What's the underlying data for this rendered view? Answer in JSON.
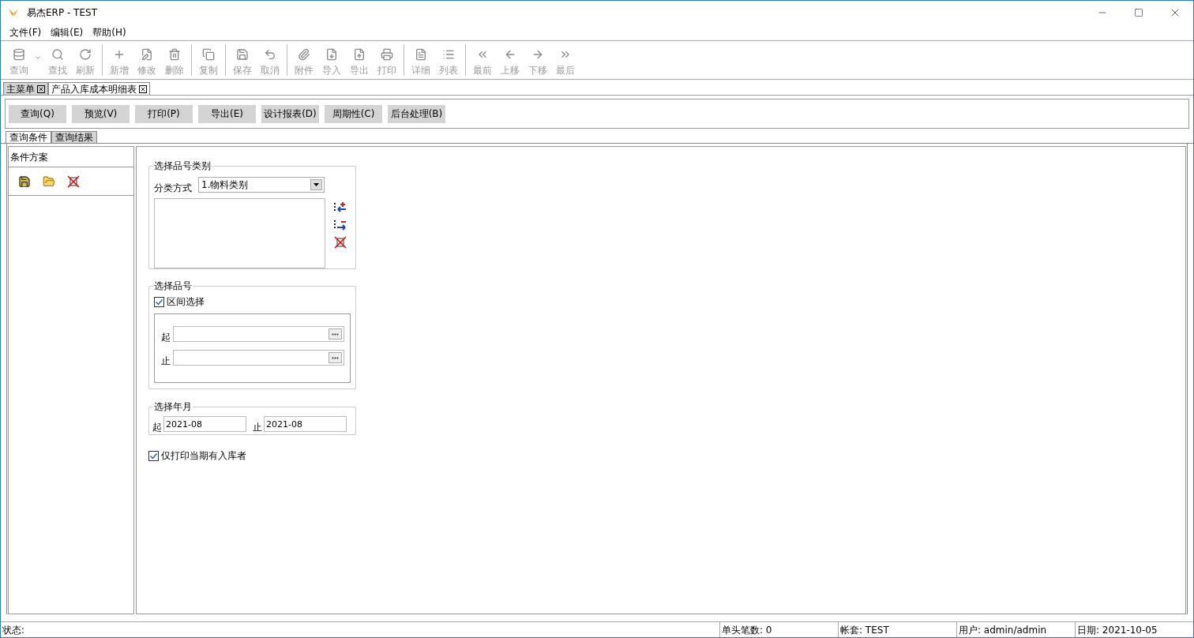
{
  "window": {
    "title": "易杰ERP - TEST"
  },
  "menu": [
    {
      "label": "文件(F)"
    },
    {
      "label": "编辑(E)"
    },
    {
      "label": "帮助(H)"
    }
  ],
  "toolbar": [
    [
      {
        "label": "查询",
        "disabled": true,
        "dropdown": true
      },
      {
        "label": "查找",
        "disabled": true,
        "dropdown": false
      },
      {
        "label": "刷新",
        "disabled": true,
        "dropdown": false
      }
    ],
    [
      {
        "label": "新增",
        "disabled": true,
        "dropdown": false
      },
      {
        "label": "修改",
        "disabled": true,
        "dropdown": false
      },
      {
        "label": "删除",
        "disabled": true,
        "dropdown": false
      }
    ],
    [
      {
        "label": "复制",
        "disabled": true,
        "dropdown": false
      }
    ],
    [
      {
        "label": "保存",
        "disabled": true,
        "dropdown": false
      },
      {
        "label": "取消",
        "disabled": true,
        "dropdown": false
      }
    ],
    [
      {
        "label": "附件",
        "disabled": true,
        "dropdown": false
      },
      {
        "label": "导入",
        "disabled": true,
        "dropdown": false
      },
      {
        "label": "导出",
        "disabled": true,
        "dropdown": false
      },
      {
        "label": "打印",
        "disabled": true,
        "dropdown": false
      }
    ],
    [
      {
        "label": "详细",
        "disabled": true,
        "dropdown": false
      },
      {
        "label": "列表",
        "disabled": true,
        "dropdown": false
      }
    ],
    [
      {
        "label": "最前",
        "disabled": true,
        "dropdown": false
      },
      {
        "label": "上移",
        "disabled": true,
        "dropdown": false
      },
      {
        "label": "下移",
        "disabled": true,
        "dropdown": false
      },
      {
        "label": "最后",
        "disabled": true,
        "dropdown": false
      }
    ]
  ],
  "doc_tabs": [
    {
      "label": "主菜单",
      "selected": false
    },
    {
      "label": "产品入库成本明细表",
      "selected": true
    }
  ],
  "actions": [
    "查询(Q)",
    "预览(V)",
    "打印(P)",
    "导出(E)",
    "设计报表(D)",
    "周期性(C)",
    "后台处理(B)"
  ],
  "sub_tabs": [
    {
      "label": "查询条件",
      "selected": true
    },
    {
      "label": "查询结果",
      "selected": false
    }
  ],
  "scheme_panel": {
    "title": "条件方案"
  },
  "category_group": {
    "legend": "选择品号类别",
    "classify_label": "分类方式",
    "classify_value": "1.物料类别"
  },
  "item_group": {
    "legend": "选择品号",
    "range_label": "区间选择",
    "range_checked": true,
    "from_label": "起",
    "to_label": "止"
  },
  "period_group": {
    "legend": "选择年月",
    "from_label": "起",
    "from_value": "2021-08",
    "to_label": "止",
    "to_value": "2021-08"
  },
  "only_current": {
    "label": "仅打印当期有入库者",
    "checked": true
  },
  "status_bar": {
    "status": "状态:",
    "cells": [
      "单头笔数: 0",
      "帐套: TEST",
      "用户: admin/admin",
      "日期: 2021-10-05"
    ]
  }
}
